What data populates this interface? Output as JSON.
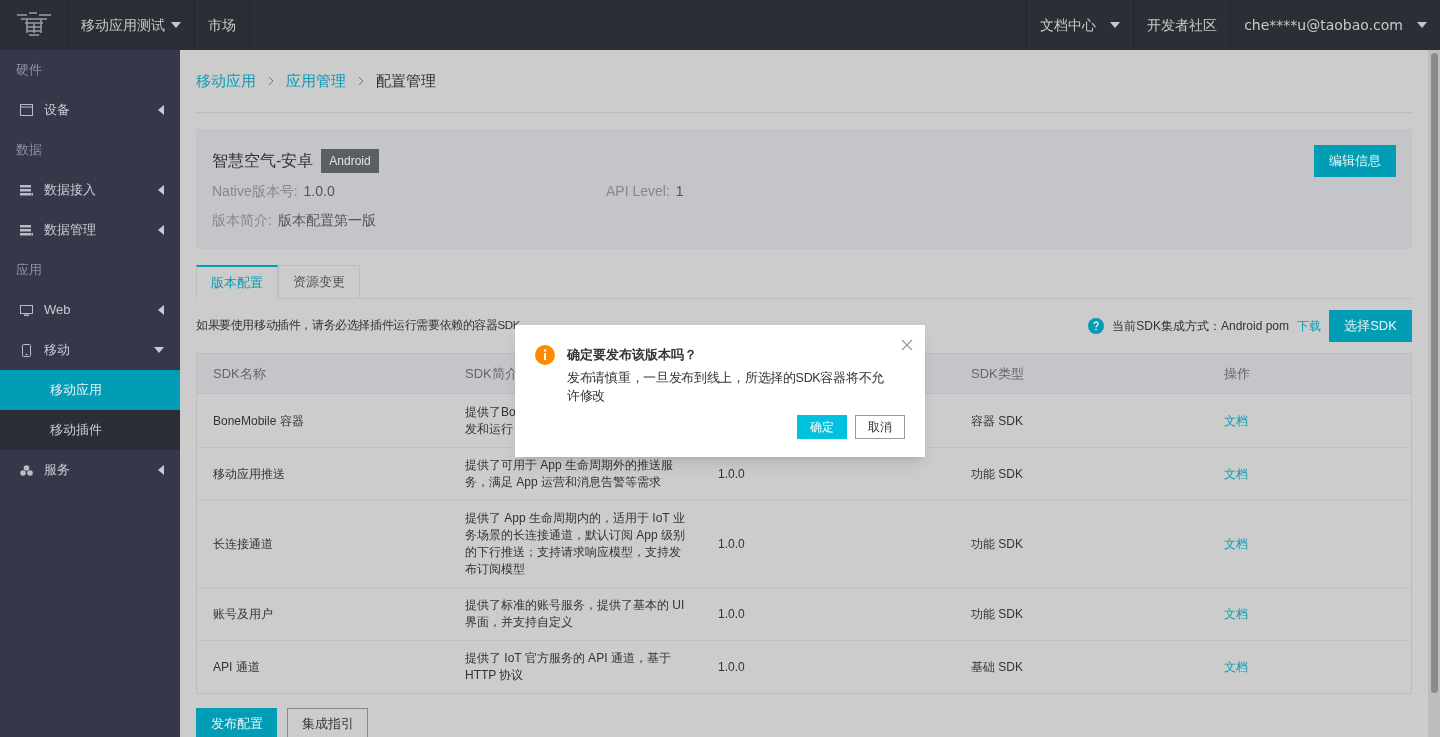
{
  "topbar": {
    "left": [
      {
        "label": "移动应用测试",
        "dropdown": true
      },
      {
        "label": "市场",
        "dropdown": false
      }
    ],
    "right": [
      {
        "label": "文档中心",
        "dropdown": true
      },
      {
        "label": "开发者社区",
        "dropdown": false
      },
      {
        "label": "che****u@taobao.com",
        "dropdown": true
      }
    ]
  },
  "sidebar": {
    "sections": [
      {
        "label": "硬件",
        "items": [
          {
            "label": "设备",
            "kind": "device",
            "expanded": false
          }
        ]
      },
      {
        "label": "数据",
        "items": [
          {
            "label": "数据接入",
            "kind": "data",
            "expanded": false
          },
          {
            "label": "数据管理",
            "kind": "data",
            "expanded": false
          }
        ]
      },
      {
        "label": "应用",
        "items": [
          {
            "label": "Web",
            "kind": "monitor",
            "expanded": false
          },
          {
            "label": "移动",
            "kind": "phone",
            "expanded": true,
            "children": [
              {
                "label": "移动应用",
                "selected": true
              },
              {
                "label": "移动插件",
                "selected": false
              }
            ]
          },
          {
            "label": "服务",
            "kind": "service",
            "expanded": false
          }
        ]
      }
    ]
  },
  "breadcrumb": [
    {
      "label": "移动应用",
      "link": true
    },
    {
      "label": "应用管理",
      "link": true
    },
    {
      "label": "配置管理",
      "link": false
    }
  ],
  "app": {
    "name": "智慧空气-安卓",
    "platform": "Android",
    "edit_button": "编辑信息",
    "fields": [
      {
        "label": "Native版本号:",
        "value": "1.0.0"
      },
      {
        "label": "API Level:",
        "value": "1"
      },
      {
        "label": "版本简介:",
        "value": "版本配置第一版"
      }
    ]
  },
  "tabs": [
    {
      "label": "版本配置",
      "selected": true
    },
    {
      "label": "资源变更",
      "selected": false
    }
  ],
  "notice": "如果要使用移动插件，请务必选择插件运行需要依赖的容器SDK",
  "sdk_info": {
    "text": "当前SDK集成方式：Android pom",
    "link": "下载",
    "button": "选择SDK"
  },
  "table": {
    "columns": [
      "SDK名称",
      "SDK简介",
      null,
      "SDK类型",
      "操作"
    ],
    "rows": [
      {
        "name": "BoneMobile 容器",
        "intro": "提供了Bo\n发和运行",
        "version": null,
        "type": "容器 SDK",
        "action": "文档"
      },
      {
        "name": "移动应用推送",
        "intro": "提供了可用于 App 生命周期外的推送服务，满足 App 运营和消息告警等需求",
        "version": "1.0.0",
        "type": "功能 SDK",
        "action": "文档"
      },
      {
        "name": "长连接通道",
        "intro": "提供了 App 生命周期内的，适用于 IoT 业务场景的长连接通道，默认订阅 App 级别的下行推送；支持请求响应模型，支持发布订阅模型",
        "version": "1.0.0",
        "type": "功能 SDK",
        "action": "文档"
      },
      {
        "name": "账号及用户",
        "intro": "提供了标准的账号服务，提供了基本的 UI 界面，并支持自定义",
        "version": "1.0.0",
        "type": "功能 SDK",
        "action": "文档"
      },
      {
        "name": "API 通道",
        "intro": "提供了 IoT 官方服务的 API 通道，基于 HTTP 协议",
        "version": "1.0.0",
        "type": "基础 SDK",
        "action": "文档"
      }
    ]
  },
  "footer_buttons": [
    {
      "label": "发布配置",
      "primary": true
    },
    {
      "label": "集成指引",
      "primary": false
    }
  ],
  "dialog": {
    "title": "确定要发布该版本吗？",
    "message": "发布请慎重，一旦发布到线上，所选择的SDK容器将不允许修改",
    "buttons": [
      {
        "label": "确定",
        "primary": true
      },
      {
        "label": "取消",
        "primary": false
      }
    ]
  }
}
